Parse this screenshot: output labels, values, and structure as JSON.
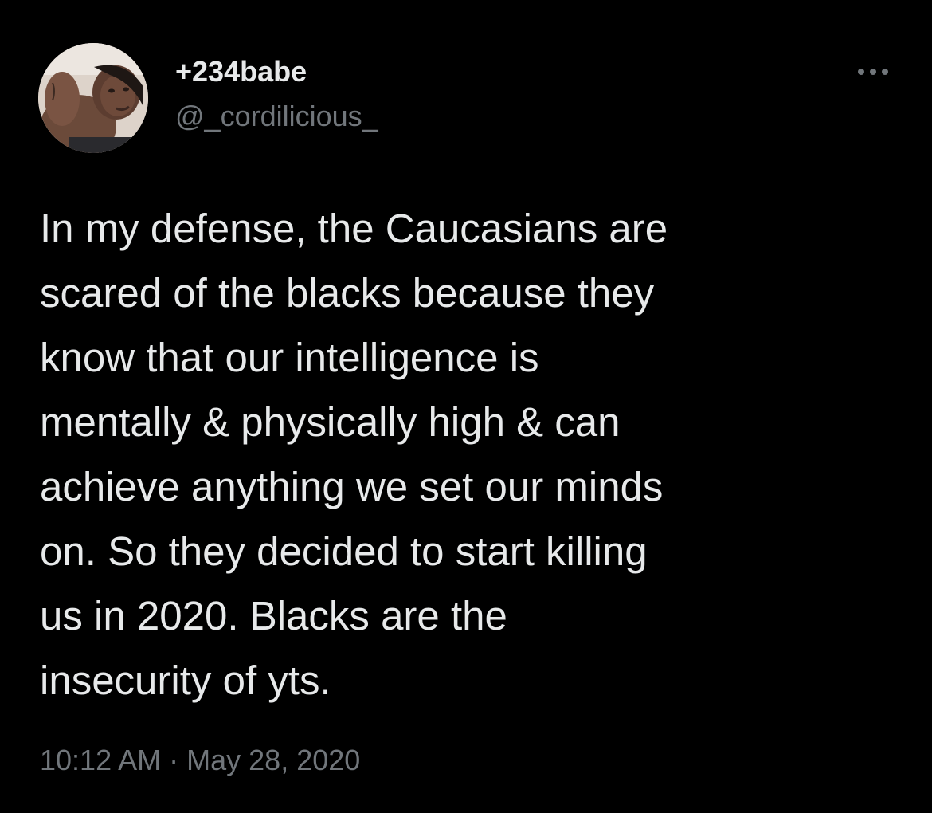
{
  "author": {
    "display_name": "+234babe",
    "handle": "@_cordilicious_",
    "avatar_icon": "profile-photo"
  },
  "menu": {
    "icon": "more-horizontal-icon"
  },
  "tweet": {
    "lines": [
      "In my defense, the Caucasians are",
      "scared of the blacks because they",
      "know that our intelligence is",
      "mentally & physically high & can",
      "achieve anything we set our minds",
      "on. So they decided to start killing",
      "us in 2020. Blacks are the",
      "insecurity of yts."
    ],
    "time": "10:12 AM",
    "separator": "·",
    "date": "May 28, 2020"
  },
  "colors": {
    "background": "#000000",
    "primary_text": "#e7e9ea",
    "secondary_text": "#71767b"
  }
}
